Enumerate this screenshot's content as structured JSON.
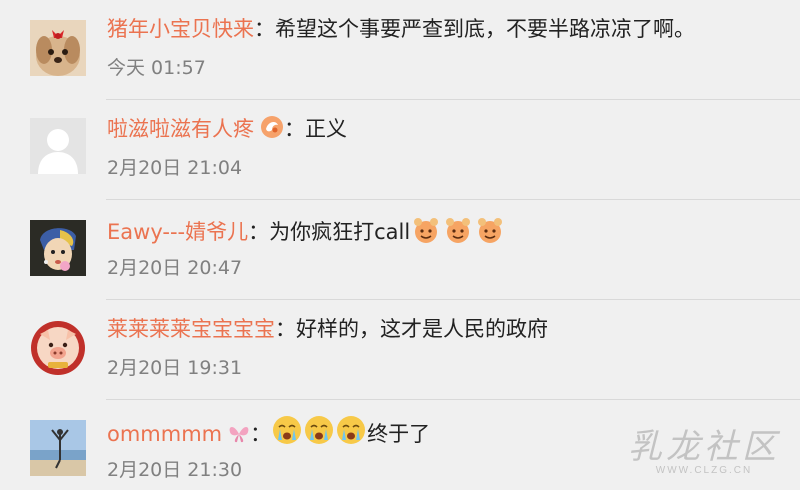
{
  "comments": [
    {
      "author": "猪年小宝贝快来",
      "text": "希望这个事要严查到底，不要半路凉凉了啊。",
      "time": "今天 01:57",
      "avatar_icon": "puppy-avatar-icon"
    },
    {
      "author": "啦滋啦滋有人疼",
      "text": "正义",
      "time": "2月20日 21:04",
      "avatar_icon": "default-avatar-icon",
      "badge_icon": "orange-badge-icon"
    },
    {
      "author": "Eawy---婧爷儿",
      "text": "为你疯狂打call",
      "time": "2月20日 20:47",
      "avatar_icon": "girl-pearl-earring-avatar-icon",
      "emoji_icon": "cheer-emoji-icon",
      "emoji_count": 3
    },
    {
      "author": "莱莱莱莱宝宝宝宝",
      "text": "好样的，这才是人民的政府",
      "time": "2月20日 19:31",
      "avatar_icon": "pig-avatar-icon"
    },
    {
      "author": "ommmmm",
      "text": "终于了",
      "time": "2月20日 21:30",
      "avatar_icon": "beach-avatar-icon",
      "badge_icon": "butterfly-icon",
      "emoji_icon": "crying-emoji-icon",
      "emoji_count": 3
    }
  ],
  "colon": "：",
  "watermark": {
    "main": "乳龙社区",
    "sub": "WWW.CLZG.CN"
  },
  "colors": {
    "author": "#eb7350",
    "text": "#222222",
    "time": "#808080",
    "background": "#f0f0f0"
  }
}
